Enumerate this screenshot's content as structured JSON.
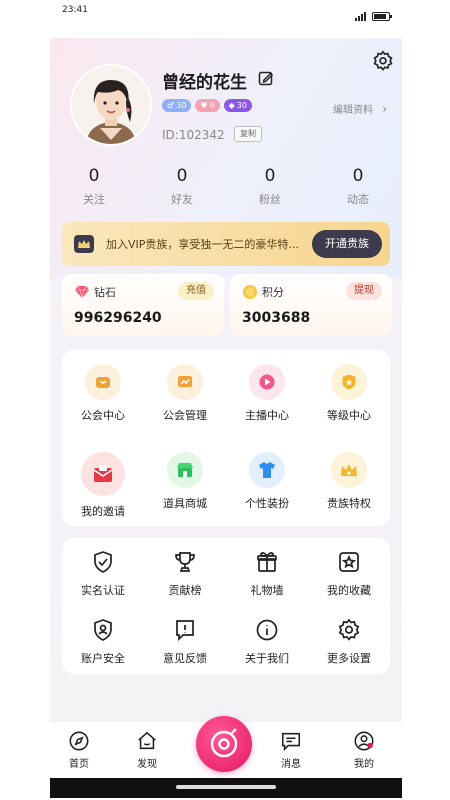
{
  "status_bar": {
    "time": "23:41"
  },
  "profile": {
    "nickname": "曾经的花生",
    "badges": [
      {
        "icon": "level-icon",
        "value": "30",
        "color": "#8fb0f5"
      },
      {
        "icon": "heart-level-icon",
        "value": "9",
        "color": "#f4a1b4"
      },
      {
        "icon": "gem-level-icon",
        "value": "30",
        "color": "#8a57e6"
      }
    ],
    "user_id": "ID:102342",
    "copy_label": "复制",
    "edit_profile_label": "编辑资料",
    "edit_profile_chevron": "›"
  },
  "stats": [
    {
      "value": "0",
      "label": "关注"
    },
    {
      "value": "0",
      "label": "好友"
    },
    {
      "value": "0",
      "label": "粉丝"
    },
    {
      "value": "0",
      "label": "动态"
    }
  ],
  "vip_banner": {
    "text": "加入VIP贵族，享受独一无二的豪华特...",
    "button_label": "开通贵族"
  },
  "wallet": {
    "diamond": {
      "label": "钻石",
      "value": "996296240",
      "button": "充值"
    },
    "points": {
      "label": "积分",
      "value": "3003688",
      "button": "提现"
    }
  },
  "main_features": [
    {
      "label": "公会中心",
      "icon": "guild-center-icon"
    },
    {
      "label": "公会管理",
      "icon": "guild-manage-icon"
    },
    {
      "label": "主播中心",
      "icon": "streamer-center-icon"
    },
    {
      "label": "等级中心",
      "icon": "level-center-icon"
    },
    {
      "label": "我的邀请",
      "icon": "invite-icon"
    },
    {
      "label": "道具商城",
      "icon": "store-icon"
    },
    {
      "label": "个性装扮",
      "icon": "outfit-icon"
    },
    {
      "label": "贵族特权",
      "icon": "crown-icon"
    }
  ],
  "more_features": [
    {
      "label": "实名认证",
      "icon": "shield-check-icon"
    },
    {
      "label": "贡献榜",
      "icon": "trophy-icon"
    },
    {
      "label": "礼物墙",
      "icon": "gift-icon"
    },
    {
      "label": "我的收藏",
      "icon": "star-icon"
    },
    {
      "label": "账户安全",
      "icon": "account-security-icon"
    },
    {
      "label": "意见反馈",
      "icon": "feedback-icon"
    },
    {
      "label": "关于我们",
      "icon": "info-icon"
    },
    {
      "label": "更多设置",
      "icon": "gear-icon"
    }
  ],
  "tab_bar": [
    {
      "label": "首页",
      "icon": "compass-icon"
    },
    {
      "label": "发现",
      "icon": "discover-icon"
    },
    {
      "label": "",
      "icon": "live-camera-icon"
    },
    {
      "label": "消息",
      "icon": "message-icon"
    },
    {
      "label": "我的",
      "icon": "profile-icon"
    }
  ],
  "colors": {
    "accent": "#e4165f",
    "vip_gold": "#f6d58e",
    "dark_button": "#3c3a4d"
  }
}
